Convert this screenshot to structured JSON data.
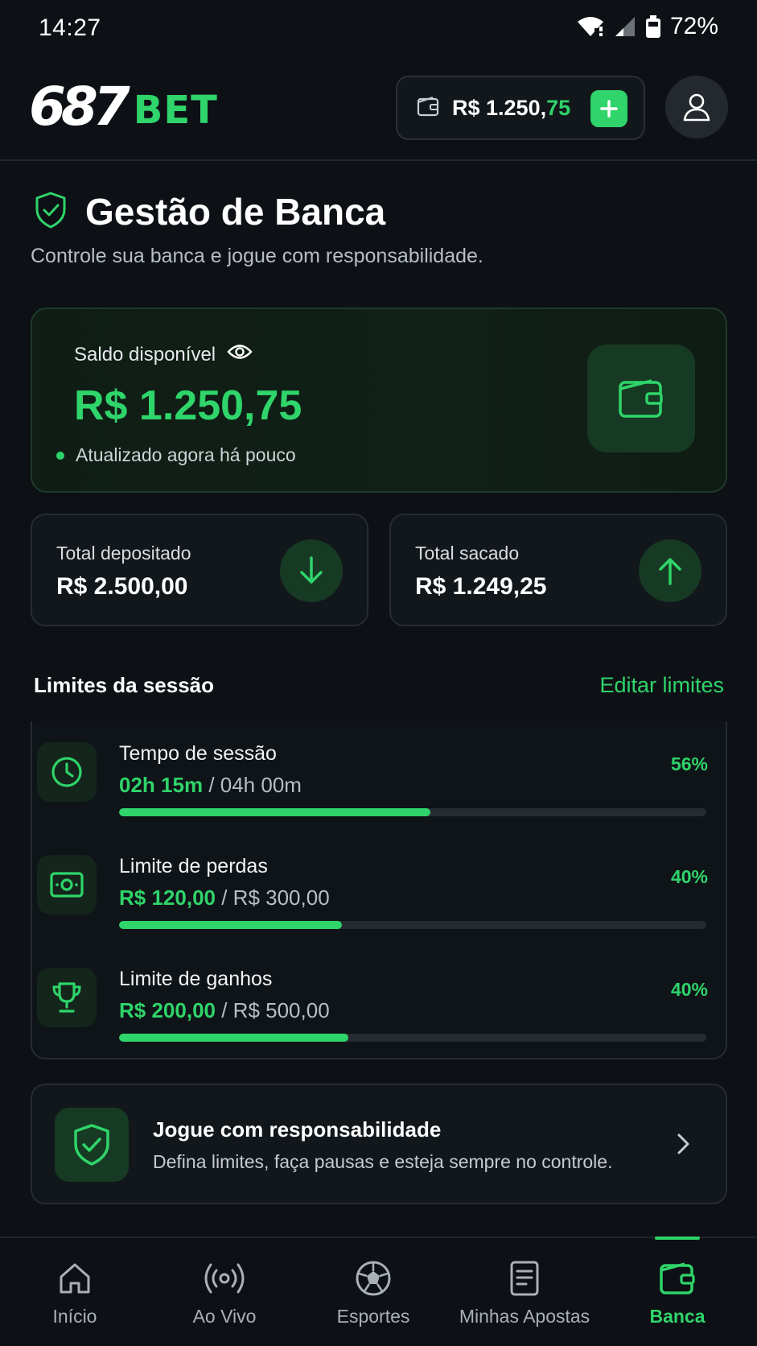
{
  "status_bar": {
    "time": "14:27",
    "battery": "72%"
  },
  "header": {
    "logo_number": "687",
    "logo_text": "BET",
    "balance_int": "R$ 1.250,",
    "balance_dec": "75"
  },
  "page": {
    "title": "Gestão de Banca",
    "subtitle": "Controle sua banca e jogue com responsabilidade."
  },
  "balance_card": {
    "label": "Saldo disponível",
    "amount": "R$ 1.250,75",
    "updated": "Atualizado agora há pouco"
  },
  "stats": {
    "deposited_label": "Total depositado",
    "deposited_value": "R$ 2.500,00",
    "withdrawn_label": "Total sacado",
    "withdrawn_value": "R$ 1.249,25"
  },
  "limits": {
    "title": "Limites da sessão",
    "edit_label": "Editar limites",
    "items": [
      {
        "name": "Tempo de sessão",
        "current": "02h 15m",
        "max": "/ 04h 00m",
        "percent_label": "56%",
        "progress": 0.53,
        "icon": "clock-icon"
      },
      {
        "name": "Limite de perdas",
        "current": "R$ 120,00",
        "max": "/ R$ 300,00",
        "percent_label": "40%",
        "progress": 0.38,
        "icon": "money-icon"
      },
      {
        "name": "Limite de ganhos",
        "current": "R$ 200,00",
        "max": "/ R$ 500,00",
        "percent_label": "40%",
        "progress": 0.39,
        "icon": "trophy-icon"
      }
    ]
  },
  "responsibility": {
    "title": "Jogue com responsabilidade",
    "subtitle": "Defina limites, faça pausas e esteja sempre no controle."
  },
  "nav": {
    "items": [
      {
        "label": "Início",
        "icon": "home-icon"
      },
      {
        "label": "Ao Vivo",
        "icon": "live-icon"
      },
      {
        "label": "Esportes",
        "icon": "soccer-ball-icon"
      },
      {
        "label": "Minhas Apostas",
        "icon": "bet-slip-icon"
      },
      {
        "label": "Banca",
        "icon": "wallet-icon"
      }
    ],
    "active": "Banca"
  },
  "colors": {
    "accent": "#2fd46a",
    "background": "#0d1115"
  }
}
